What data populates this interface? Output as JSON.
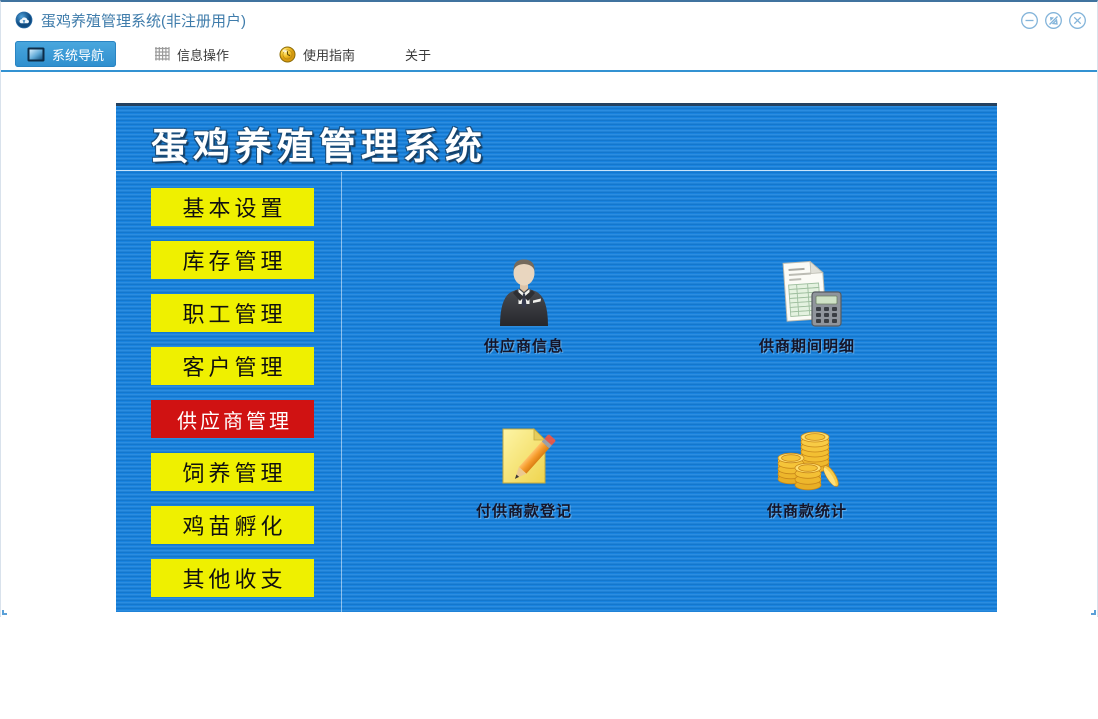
{
  "window": {
    "title": "蛋鸡养殖管理系统(非注册用户)",
    "controls": {
      "minimize": "minimize",
      "maximize": "maximize",
      "close": "close"
    }
  },
  "toolbar": {
    "tabs": [
      {
        "label": "系统导航",
        "icon": "monitor-icon",
        "active": true
      },
      {
        "label": "信息操作",
        "icon": "grid-icon",
        "active": false
      },
      {
        "label": "使用指南",
        "icon": "help-ball-icon",
        "active": false
      },
      {
        "label": "关于",
        "icon": "",
        "active": false
      }
    ]
  },
  "panel": {
    "title": "蛋鸡养殖管理系统",
    "sidebar": [
      {
        "label": "基本设置",
        "active": false
      },
      {
        "label": "库存管理",
        "active": false
      },
      {
        "label": "职工管理",
        "active": false
      },
      {
        "label": "客户管理",
        "active": false
      },
      {
        "label": "供应商管理",
        "active": true
      },
      {
        "label": "饲养管理",
        "active": false
      },
      {
        "label": "鸡苗孵化",
        "active": false
      },
      {
        "label": "其他收支",
        "active": false
      }
    ],
    "shortcuts": [
      {
        "label": "供应商信息",
        "icon": "businessman-icon"
      },
      {
        "label": "供商期间明细",
        "icon": "invoice-calculator-icon"
      },
      {
        "label": "付供商款登记",
        "icon": "note-pencil-icon"
      },
      {
        "label": "供商款统计",
        "icon": "gold-coins-icon"
      }
    ],
    "colors": {
      "panel_blue": "#1480dd",
      "button_yellow": "#eff000",
      "button_active_red": "#d01212",
      "tab_active_blue": "#3b98d4",
      "title_text_blue": "#3f7cab"
    }
  }
}
